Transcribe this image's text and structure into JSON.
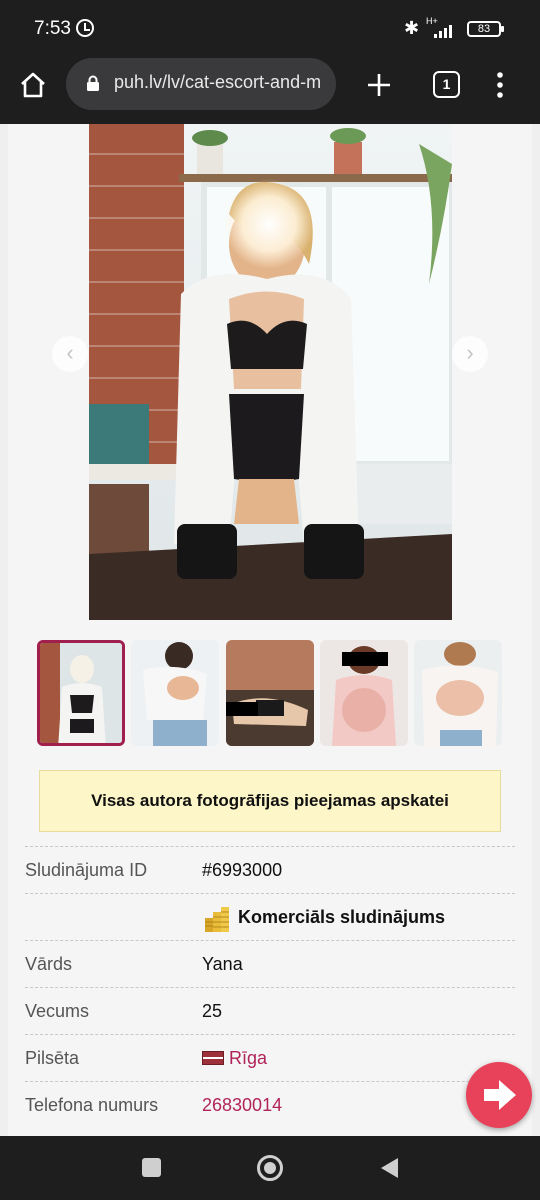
{
  "status_bar": {
    "time": "7:53",
    "network_label": "H+",
    "battery_level": "83"
  },
  "browser": {
    "url": "puh.lv/lv/cat-escort-and-m",
    "tab_count": "1"
  },
  "gallery": {
    "thumbnail_count": 5,
    "active_thumbnail": 1
  },
  "notice": {
    "text": "Visas autora fotogrāfijas pieejamas apskatei"
  },
  "details": {
    "id_label": "Sludinājuma ID",
    "id_value": "#6993000",
    "commercial_label": "Komerciāls sludinājums",
    "name_label": "Vārds",
    "name_value": "Yana",
    "age_label": "Vecums",
    "age_value": "25",
    "city_label": "Pilsēta",
    "city_value": "Rīga",
    "phone_label": "Telefona numurs",
    "phone_value": "26830014"
  },
  "colors": {
    "accent": "#b0245a",
    "fab": "#e8425a",
    "notice_bg": "#fdf6c9"
  }
}
